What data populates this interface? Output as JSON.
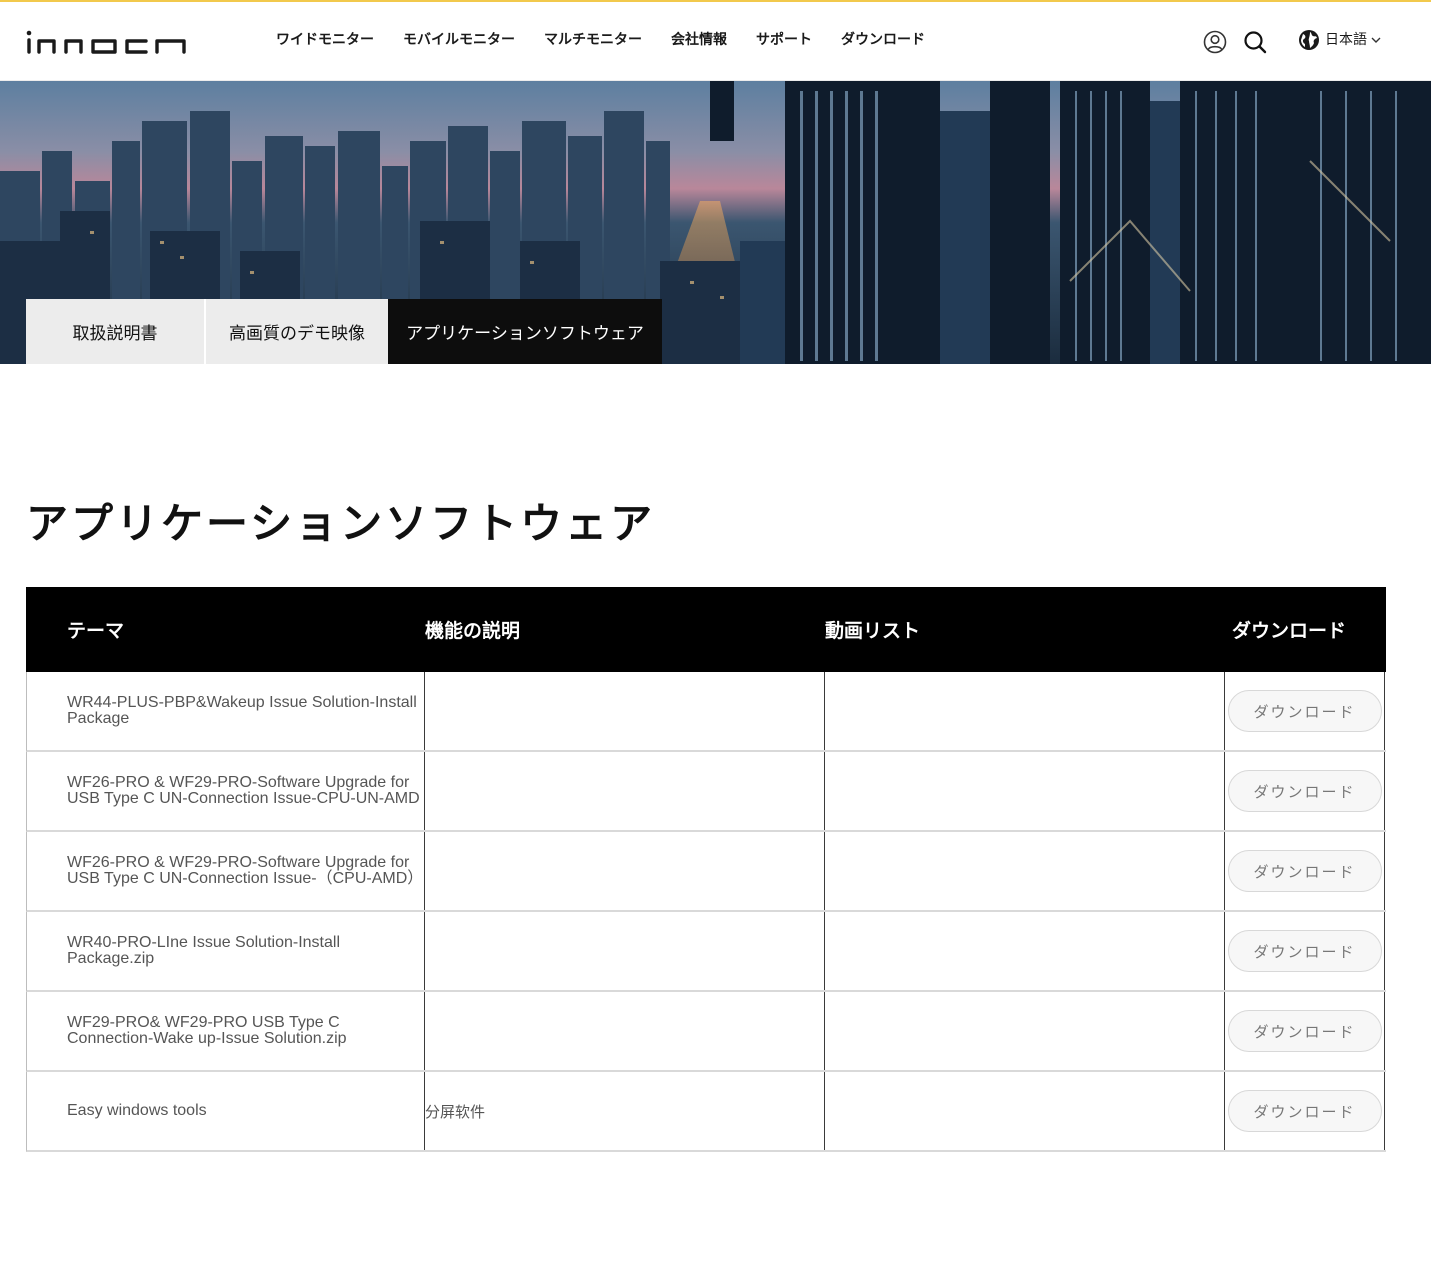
{
  "header": {
    "logo_text": "innocn",
    "nav": [
      "ワイドモニター",
      "モバイルモニター",
      "マルチモニター",
      "会社情報",
      "サポート",
      "ダウンロード"
    ],
    "language": "日本語"
  },
  "hero": {
    "tabs": [
      "取扱説明書",
      "高画質のデモ映像",
      "アプリケーションソフトウェア"
    ],
    "active_tab": "アプリケーションソフトウェア"
  },
  "page_title": "アプリケーションソフトウェア",
  "table": {
    "headers": [
      "テーマ",
      "機能の説明",
      "動画リスト",
      "ダウンロード"
    ],
    "rows": [
      {
        "theme": "WR44-PLUS-PBP&Wakeup Issue Solution-Install Package",
        "description": "",
        "video": "",
        "download": "ダウンロード"
      },
      {
        "theme": "WF26-PRO & WF29-PRO-Software Upgrade for USB Type C UN-Connection Issue-CPU-UN-AMD",
        "description": "",
        "video": "",
        "download": "ダウンロード"
      },
      {
        "theme": "WF26-PRO & WF29-PRO-Software Upgrade for USB Type C UN-Connection Issue-（CPU-AMD）",
        "description": "",
        "video": "",
        "download": "ダウンロード"
      },
      {
        "theme": "WR40-PRO-LIne Issue Solution-Install Package.zip",
        "description": "",
        "video": "",
        "download": "ダウンロード"
      },
      {
        "theme": "WF29-PRO& WF29-PRO USB Type C Connection-Wake up-Issue Solution.zip",
        "description": "",
        "video": "",
        "download": "ダウンロード"
      },
      {
        "theme": "Easy windows tools",
        "description": "分屏软件",
        "video": "",
        "download": "ダウンロード"
      }
    ]
  },
  "colors": {
    "top_accent": "#f2c94c",
    "table_header_bg": "#000000",
    "active_tab_bg": "#0d0d0d",
    "inactive_tab_bg": "#ececec"
  }
}
